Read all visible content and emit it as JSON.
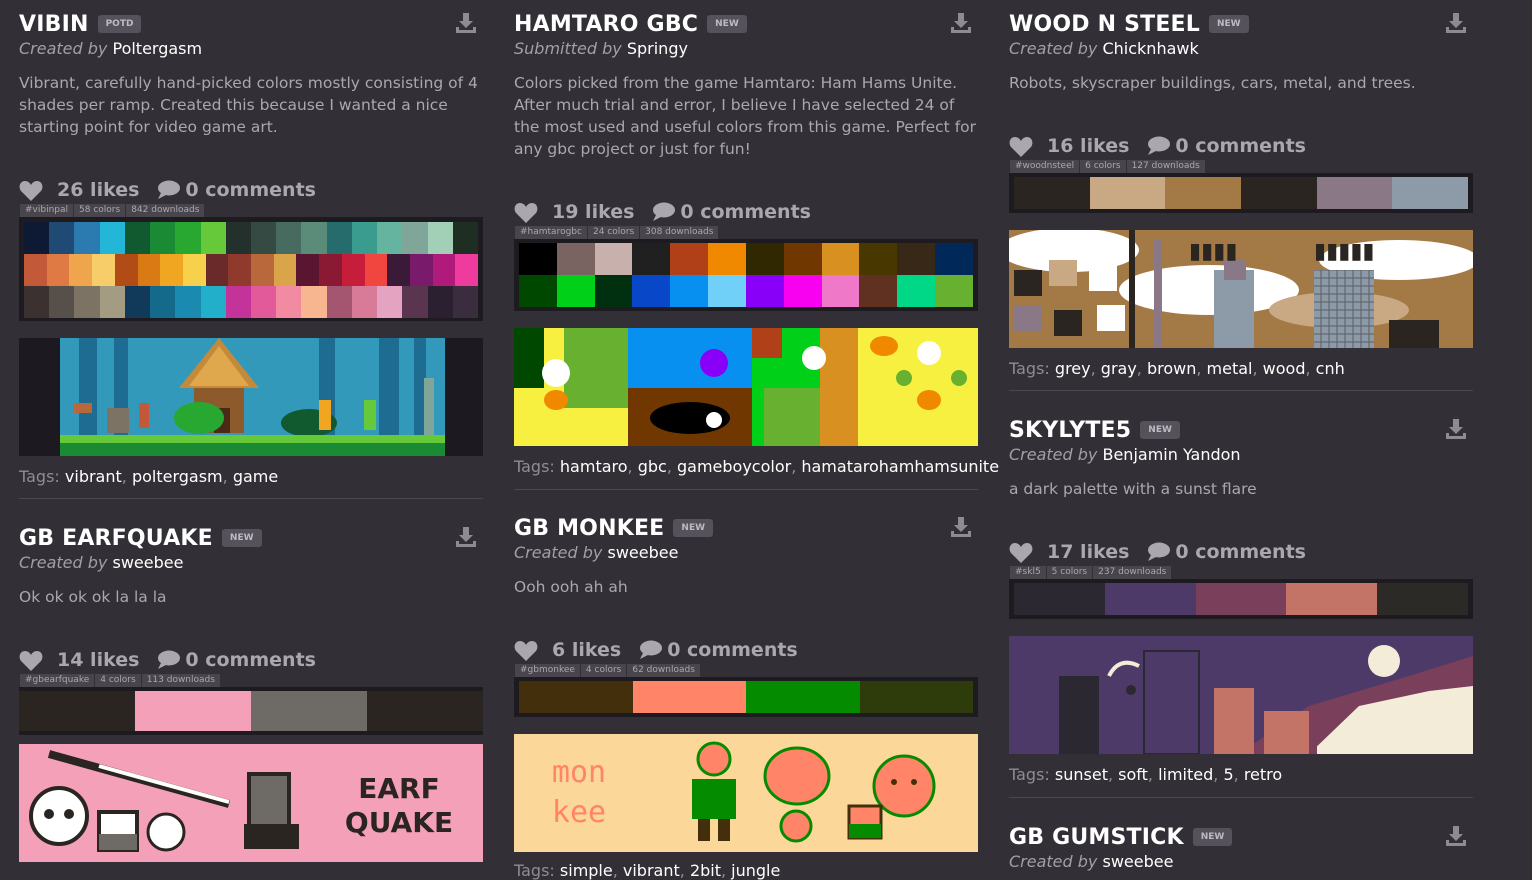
{
  "cards": {
    "vibin": {
      "title": "VIBIN",
      "badge": "POTD",
      "by_prefix": "Created by",
      "author": "Poltergasm",
      "desc": "Vibrant, carefully hand-picked colors mostly consisting of 4 shades per ramp. Created this because I wanted a nice starting point for video game art.",
      "likes": "26 likes",
      "comments": "0 comments",
      "hashtag": "#vibinpal",
      "colors": "58 colors",
      "downloads": "842 downloads",
      "tags_label": "Tags:",
      "tags": [
        "vibrant",
        "poltergasm",
        "game"
      ],
      "swatches": [
        [
          "#0e1a33",
          "#1e4a74",
          "#2b7ab0",
          "#23b6d6",
          "#115a2f",
          "#1a8a35",
          "#28a830",
          "#66c93a",
          "#23302c",
          "#344a42",
          "#476b5e",
          "#5b8b79",
          "#276c6c",
          "#3a9b8f",
          "#64b49f",
          "#7fa699",
          "#a1d0b6",
          "#1f2e22"
        ],
        [
          "#c25a3a",
          "#e07a45",
          "#efa54c",
          "#f7cd6a",
          "#b24c16",
          "#d97a14",
          "#f0a620",
          "#f7d14c",
          "#6b2a2a",
          "#8f3a2c",
          "#b8683a",
          "#d9a44a",
          "#5a1630",
          "#8a1a33",
          "#c61e3a",
          "#f0463f",
          "#3a1a38",
          "#7a1a6a",
          "#b01a7a",
          "#ef3b9e"
        ],
        [
          "#3a3130",
          "#57504a",
          "#7c7364",
          "#a39c83",
          "#113a5a",
          "#136a8a",
          "#1a8ab0",
          "#22afc9",
          "#c3339a",
          "#e35a9a",
          "#f28aa2",
          "#f7b68f",
          "#a45670",
          "#d77b98",
          "#e4a3c0",
          "#5a3550",
          "#2a2030",
          "#3a2d3e"
        ]
      ]
    },
    "hamtaro": {
      "title": "HAMTARO GBC",
      "badge": "NEW",
      "by_prefix": "Submitted by",
      "author": "Springy",
      "desc": "Colors picked from the game Hamtaro: Ham Hams Unite. After much trial and error, I believe I have selected 24 of the most used and useful colors from this game. Perfect for any gbc project or just for fun!",
      "likes": "19 likes",
      "comments": "0 comments",
      "hashtag": "#hamtarogbc",
      "colors": "24 colors",
      "downloads": "308 downloads",
      "tags_label": "Tags:",
      "tags": [
        "hamtaro",
        "gbc",
        "gameboycolor",
        "hamatarohamhamsunite"
      ],
      "swatches": [
        [
          "#000000",
          "#7a6462",
          "#c8b0ac",
          "#202020",
          "#b04018",
          "#f08800",
          "#302800",
          "#703800",
          "#d89020",
          "#483800",
          "#382818",
          "#002858"
        ],
        [
          "#004800",
          "#00d018",
          "#003010",
          "#0848c8",
          "#0890f0",
          "#70d0f8",
          "#8800f8",
          "#f800f0",
          "#f078c8",
          "#603020",
          "#00d888",
          "#68b030"
        ]
      ]
    },
    "woodnsteel": {
      "title": "WOOD N STEEL",
      "badge": "NEW",
      "by_prefix": "Created by",
      "author": "Chicknhawk",
      "desc": "Robots, skyscraper buildings, cars, metal, and trees.",
      "likes": "16 likes",
      "comments": "0 comments",
      "hashtag": "#woodnsteel",
      "colors": "6 colors",
      "downloads": "127 downloads",
      "tags_label": "Tags:",
      "tags": [
        "grey",
        "gray",
        "brown",
        "metal",
        "wood",
        "cnh"
      ],
      "swatches": [
        [
          "#2a2521",
          "#c9a983",
          "#a37a45",
          "#2a2521",
          "#8a7887",
          "#8d9aa8"
        ]
      ]
    },
    "earfquake": {
      "title": "GB EARFQUAKE",
      "badge": "NEW",
      "by_prefix": "Created by",
      "author": "sweebee",
      "desc": "Ok ok ok ok la la la",
      "likes": "14 likes",
      "comments": "0 comments",
      "hashtag": "#gbearfquake",
      "colors": "4 colors",
      "downloads": "113 downloads",
      "tags_label": "Tags:",
      "tags": [],
      "swatches": [
        [
          "#2b2522",
          "#f5a0b9",
          "#6e6a66",
          "#2b2522"
        ]
      ],
      "preview_text": [
        "EARF",
        "QUAKE"
      ]
    },
    "monkee": {
      "title": "GB MONKEE",
      "badge": "NEW",
      "by_prefix": "Created by",
      "author": "sweebee",
      "desc": "Ooh ooh ah ah",
      "likes": "6 likes",
      "comments": "0 comments",
      "hashtag": "#gbmonkee",
      "colors": "4 colors",
      "downloads": "62 downloads",
      "tags_label": "Tags:",
      "tags": [
        "simple",
        "vibrant",
        "2bit",
        "jungle"
      ],
      "swatches": [
        [
          "#432f0b",
          "#ff8468",
          "#058b00",
          "#2d3c0a"
        ]
      ],
      "preview_text": [
        "mon",
        "kee"
      ]
    },
    "skylyte": {
      "title": "SKYLYTE5",
      "badge": "NEW",
      "by_prefix": "Created by",
      "author": "Benjamin Yandon",
      "desc": "a dark palette with a sunst flare",
      "likes": "17 likes",
      "comments": "0 comments",
      "hashtag": "#skl5",
      "colors": "5 colors",
      "downloads": "237 downloads",
      "tags_label": "Tags:",
      "tags": [
        "sunset",
        "soft",
        "limited",
        "5",
        "retro"
      ],
      "swatches": [
        [
          "#2b2832",
          "#4e3a68",
          "#7a3f5a",
          "#c47367",
          "#2b2a27"
        ]
      ]
    },
    "gumstick": {
      "title": "GB GUMSTICK",
      "badge": "NEW",
      "by_prefix": "Created by",
      "author": "sweebee"
    }
  },
  "colors": {
    "background": "#323036",
    "text_white": "#ffffff",
    "muted": "#aaa7ae",
    "badge_bg": "#55525b"
  },
  "icons": {
    "download": "download-icon",
    "like": "heart-icon",
    "comment": "speech-bubble-icon"
  }
}
